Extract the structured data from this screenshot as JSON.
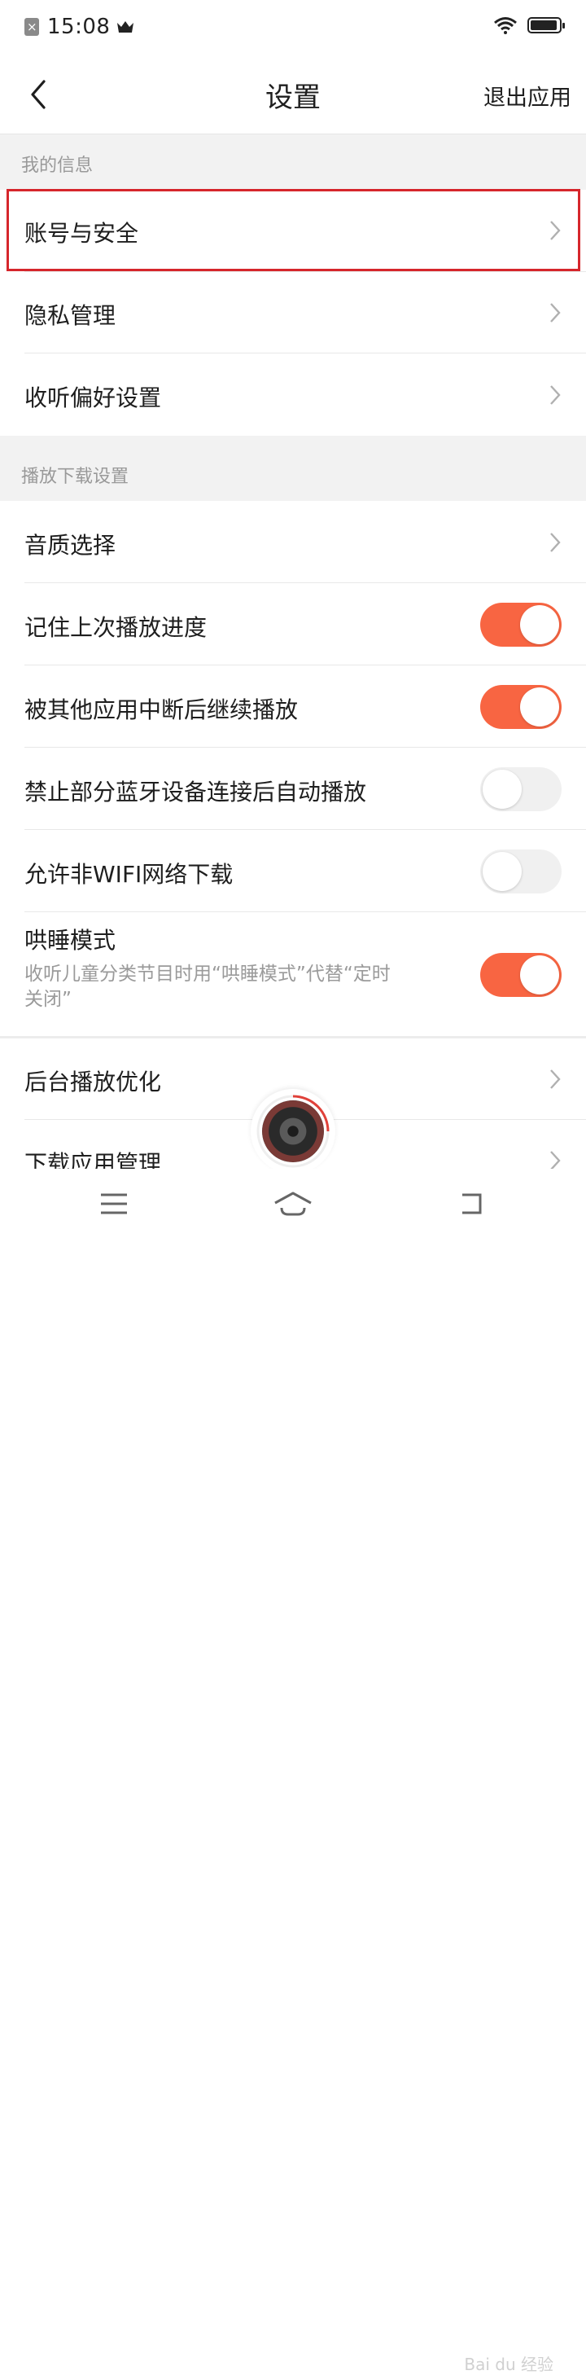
{
  "status_bar": {
    "time": "15:08"
  },
  "header": {
    "title": "设置",
    "exit_label": "退出应用"
  },
  "sections": [
    {
      "title": "我的信息"
    },
    {
      "title": "播放下载设置"
    }
  ],
  "rows": {
    "account_security": "账号与安全",
    "privacy": "隐私管理",
    "listening_pref": "收听偏好设置",
    "audio_quality": "音质选择",
    "remember_progress": "记住上次播放进度",
    "resume_after_interrupt": "被其他应用中断后继续播放",
    "block_bluetooth_autoplay": "禁止部分蓝牙设备连接后自动播放",
    "allow_non_wifi_download": "允许非WIFI网络下载",
    "sleep_mode": "哄睡模式",
    "sleep_mode_desc": "收听儿童分类节目时用“哄睡模式”代替“定时关闭”",
    "background_optimize": "后台播放优化",
    "download_app_manage": "下载应用管理"
  },
  "toggles": {
    "remember_progress": true,
    "resume_after_interrupt": true,
    "block_bluetooth_autoplay": false,
    "allow_non_wifi_download": false,
    "sleep_mode": true
  },
  "colors": {
    "accent": "#f86542",
    "highlight_border": "#d6262c",
    "section_bg": "#f2f2f2"
  },
  "icons": {
    "back": "chevron-left-icon",
    "row_arrow": "chevron-right-icon",
    "nav_menu": "menu-icon",
    "nav_home": "home-icon",
    "nav_back": "back-icon"
  },
  "watermark": "Bai du 经验"
}
